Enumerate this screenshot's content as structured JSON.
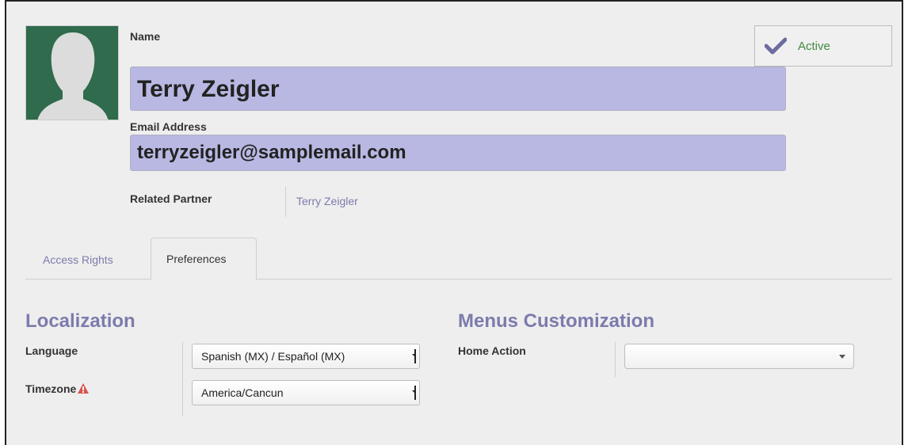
{
  "header": {
    "name_label": "Name",
    "name_value": "Terry Zeigler",
    "email_label": "Email Address",
    "email_value": "terryzeigler@samplemail.com",
    "related_partner_label": "Related Partner",
    "related_partner_value": "Terry Zeigler",
    "status": "Active"
  },
  "tabs": [
    {
      "label": "Access Rights",
      "active": false
    },
    {
      "label": "Preferences",
      "active": true
    }
  ],
  "localization": {
    "title": "Localization",
    "language_label": "Language",
    "language_value": "Spanish (MX) / Español (MX)",
    "timezone_label": "Timezone",
    "timezone_value": "America/Cancun",
    "timezone_warning_icon": "warning-triangle-icon"
  },
  "menus": {
    "title": "Menus Customization",
    "home_action_label": "Home Action",
    "home_action_value": ""
  },
  "colors": {
    "accent": "#7c7bad",
    "input_highlight": "#b8b8e3",
    "active_green": "#438843",
    "avatar_bg": "#2f6b4c",
    "warning": "#d9534f"
  }
}
